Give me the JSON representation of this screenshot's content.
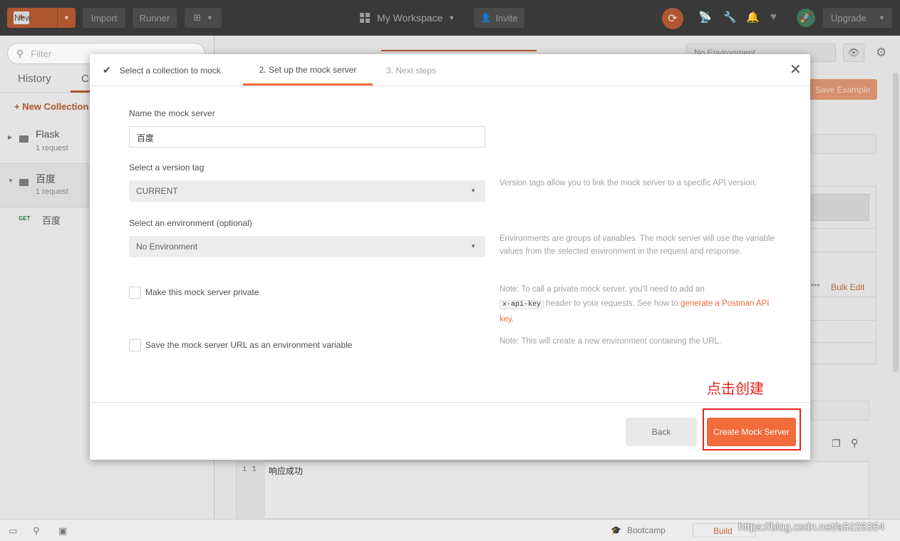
{
  "header": {
    "new_label": "New",
    "import_label": "Import",
    "runner_label": "Runner",
    "workspace_label": "My Workspace",
    "invite_label": "Invite",
    "upgrade_label": "Upgrade"
  },
  "sidebar": {
    "filter_placeholder": "Filter",
    "tab_history": "History",
    "tab_collections": "Co",
    "new_collection": "New Collection",
    "collections": [
      {
        "name": "Flask",
        "count": "1 request"
      },
      {
        "name": "百度",
        "count": "1 request"
      }
    ],
    "request": {
      "method": "GET",
      "name": "百度"
    }
  },
  "main": {
    "environment": "No Environment",
    "save_example": "Save Example",
    "bulk_edit": "Bulk Edit",
    "editor": {
      "line_no": "1",
      "code": "响应成功"
    }
  },
  "modal": {
    "steps": [
      {
        "label": "Select a collection to mock",
        "state": "done"
      },
      {
        "label": "2. Set up the mock server",
        "state": "active"
      },
      {
        "label": "3. Next steps",
        "state": "pending"
      }
    ],
    "name_label": "Name the mock server",
    "name_value": "百度",
    "version_label": "Select a version tag",
    "version_value": "CURRENT",
    "version_help": "Version tags allow you to link the mock server to a specific API version.",
    "env_label": "Select an environment (optional)",
    "env_value": "No Environment",
    "env_help": "Environments are groups of variables. The mock server will use the variable values from the selected environment in the request and response.",
    "private_label": "Make this mock server private",
    "private_help_prefix": "Note: To call a private mock server, you'll need to add an",
    "private_help_code": "x-api-key",
    "private_help_mid": "header to your requests. See how to",
    "private_help_link": "generate a Postman API key",
    "private_help_suffix": ".",
    "save_url_label": "Save the mock server URL as an environment variable",
    "save_url_help": "Note: This will create a new environment containing the URL.",
    "back_label": "Back",
    "create_label": "Create Mock Server"
  },
  "annotation": {
    "text": "点击创建",
    "color": "#e8231d"
  },
  "statusbar": {
    "bootcamp_label": "Bootcamp",
    "build_label": "Build"
  },
  "watermark": "https://blog.csdn.net/a5225354",
  "colors": {
    "accent": "#f26b3a",
    "header_bg": "#3b3b3b"
  }
}
